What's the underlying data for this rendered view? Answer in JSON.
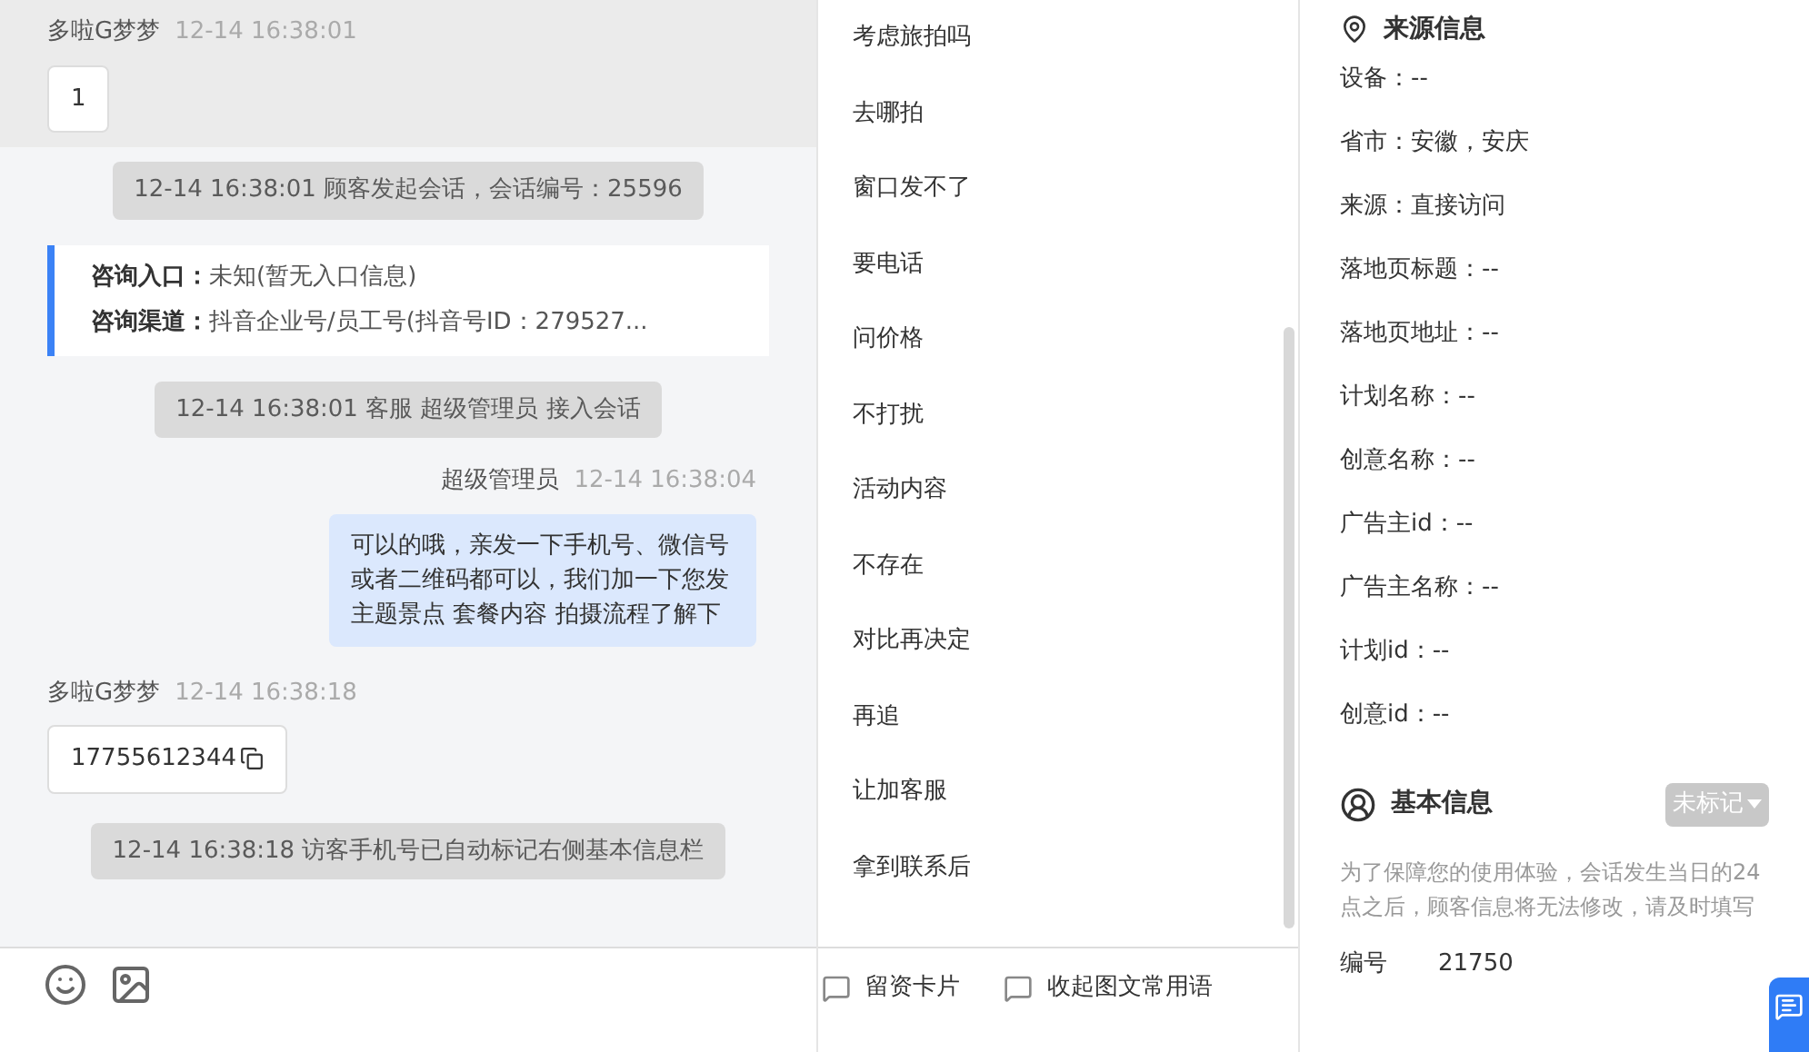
{
  "chat": {
    "messages": [
      {
        "kind": "customer",
        "sender": "多啦G梦梦",
        "time": "12-14 16:38:01",
        "text": "1",
        "copyable": false,
        "highlighted": true
      },
      {
        "kind": "system",
        "text": "12-14 16:38:01 顾客发起会话，会话编号：25596"
      },
      {
        "kind": "info",
        "lines": [
          {
            "label": "咨询入口：",
            "value": "未知(暂无入口信息)"
          },
          {
            "label": "咨询渠道：",
            "value": "抖音企业号/员工号(抖音号ID：279527..."
          }
        ]
      },
      {
        "kind": "system",
        "text": "12-14 16:38:01 客服 超级管理员 接入会话"
      },
      {
        "kind": "agent",
        "sender": "超级管理员",
        "time": "12-14 16:38:04",
        "text": "可以的哦，亲发一下手机号、微信号或者二维码都可以，我们加一下您发主题景点 套餐内容 拍摄流程了解下"
      },
      {
        "kind": "customer",
        "sender": "多啦G梦梦",
        "time": "12-14 16:38:18",
        "text": "17755612344",
        "copyable": true,
        "highlighted": false
      },
      {
        "kind": "system",
        "text": "12-14 16:38:18 访客手机号已自动标记右侧基本信息栏"
      }
    ]
  },
  "quick_replies": [
    "考虑旅拍吗",
    "去哪拍",
    "窗口发不了",
    "要电话",
    "问价格",
    "不打扰",
    "活动内容",
    "不存在",
    "对比再决定",
    "再追",
    "让加客服",
    "拿到联系后"
  ],
  "quick_actions": [
    "留资卡片",
    "收起图文常用语"
  ],
  "source_info": {
    "title": "来源信息",
    "lines": [
      "设备：--",
      "省市：安徽，安庆",
      "来源：直接访问",
      "落地页标题：--",
      "落地页地址：--",
      "计划名称：--",
      "创意名称：--",
      "广告主id：--",
      "广告主名称：--",
      "计划id：--",
      "创意id：--"
    ]
  },
  "basic_info": {
    "title": "基本信息",
    "tag": "未标记",
    "note": "为了保障您的使用体验，会话发生当日的24点之后，顾客信息将无法修改，请及时填写",
    "fields": [
      {
        "label": "编号",
        "value": "21750"
      }
    ]
  }
}
